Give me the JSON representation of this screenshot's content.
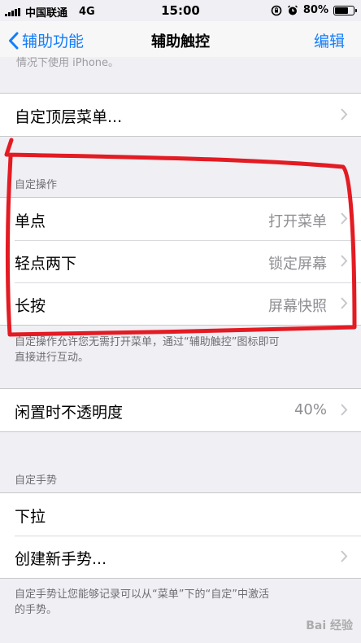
{
  "status_bar": {
    "carrier": "中国联通",
    "network": "4G",
    "time": "15:00",
    "battery": "80%",
    "battery_level": 0.8
  },
  "nav": {
    "back_label": "辅助功能",
    "title": "辅助触控",
    "action_label": "编辑"
  },
  "top_cut_text": "情况下使用 iPhone。",
  "top_menu": {
    "label": "自定顶层菜单..."
  },
  "custom_actions": {
    "header": "自定操作",
    "rows": [
      {
        "label": "单点",
        "value": "打开菜单"
      },
      {
        "label": "轻点两下",
        "value": "锁定屏幕"
      },
      {
        "label": "长按",
        "value": "屏幕快照"
      }
    ],
    "footer_line1": "自定操作允许您无需打开菜单，通过“辅助触控”图标即可",
    "footer_line2": "直接进行互动。"
  },
  "idle_opacity": {
    "label": "闲置时不透明度",
    "value": "40%"
  },
  "custom_gestures": {
    "header": "自定手势",
    "rows": [
      {
        "label": "下拉"
      },
      {
        "label": "创建新手势..."
      }
    ],
    "footer_line1": "自定手势让您能够记录可以从“菜单”下的“自定”中激活",
    "footer_line2": "的手势。"
  },
  "watermark": "Bai 经验",
  "colors": {
    "accent": "#147efb",
    "annotation": "#e31b23",
    "secondary_text": "#8e8e93",
    "background": "#efeff4"
  }
}
